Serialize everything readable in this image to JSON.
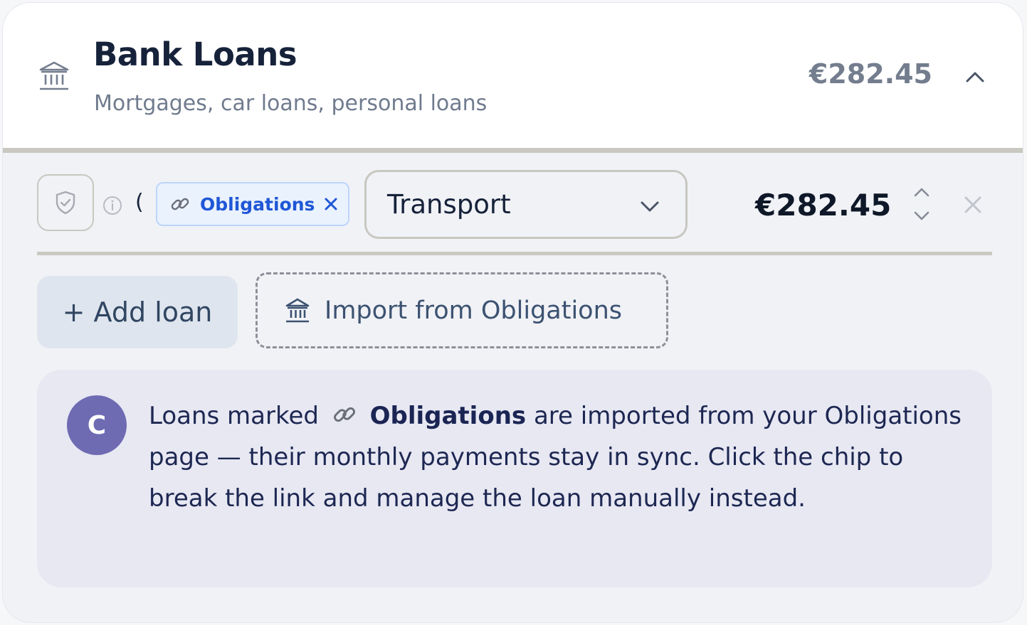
{
  "section": {
    "title": "Bank Loans",
    "subtitle": "Mortgages, car loans, personal loans",
    "total": "€282.45"
  },
  "loan_row": {
    "paren": "(",
    "chip_label": "Obligations",
    "category": "Transport",
    "amount": "€282.45"
  },
  "actions": {
    "add_loan": "+ Add loan",
    "import": "Import from Obligations"
  },
  "note": {
    "avatar_letter": "C",
    "text_before": "Loans marked",
    "bold": "Obligations",
    "text_after": "are imported from your Obligations page — their monthly payments stay in sync. Click the chip to break the link and manage the loan manually instead."
  },
  "colors": {
    "accent_blue": "#1f57d6",
    "title": "#16223a",
    "avatar": "#6e6bb3"
  },
  "icons": [
    "bank-icon",
    "chevron-up-icon",
    "shield-check-icon",
    "info-icon",
    "link-icon",
    "close-icon",
    "chevron-down-icon",
    "stepper-up-icon",
    "stepper-down-icon"
  ]
}
